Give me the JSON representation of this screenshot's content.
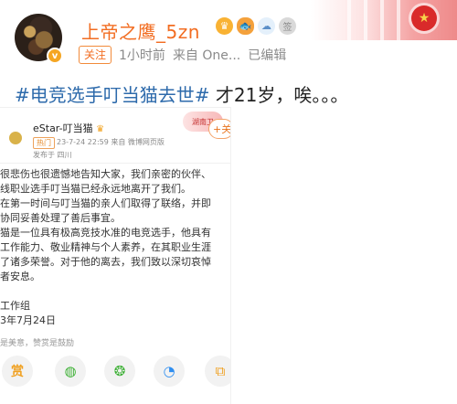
{
  "post": {
    "username": "上帝之鹰_5zn",
    "follow_tag": "关注",
    "time": "1小时前",
    "source": "来自 One...",
    "edited": "已编辑",
    "avatar_badge": "v",
    "hashtag": "#电竞选手叮当猫去世#",
    "text": " 才21岁，唉。。。",
    "icons": [
      "crown-badge-icon",
      "fish-badge-icon",
      "cloud-badge-icon",
      "sign-badge-icon"
    ],
    "icon_glyphs": {
      "crown": "♛",
      "fish": "🐟",
      "cloud": "☁",
      "sign": "签"
    },
    "banner_emblem_glyph": "★"
  },
  "embedded": {
    "account_name": "eStar-叮当猫",
    "crown_glyph": "♛",
    "tag": "热门",
    "time_line": "23-7-24 22:59  来自 微博网页版",
    "location": "发布于 四川",
    "sticker_text": "湖南卫",
    "follow_label": "+关",
    "lines": [
      "很悲伤也很遗憾地告知大家，我们亲密的伙伴、",
      "线职业选手叮当猫已经永远地离开了我们。",
      "在第一时间与叮当猫的亲人们取得了联络，并即",
      "协同妥善处理了善后事宜。",
      "猫是一位具有极高竞技水准的电竞选手，他具有",
      "工作能力、敬业精神与个人素养，在其职业生涯",
      "了诸多荣誉。对于他的离去，我们致以深切哀悼",
      "者安息。",
      "",
      "工作组",
      "3年7月24日"
    ],
    "reward_text": "是美意，赞赏是鼓励",
    "share": {
      "reward_glyph": "赏",
      "wechat_glyph": "◍",
      "moments_glyph": "❂",
      "qq_glyph": "◔",
      "more_glyph": "⧉"
    }
  },
  "colors": {
    "username": "#f26d22",
    "hashtag": "#2d6aab",
    "meta": "#8a8a8a"
  }
}
